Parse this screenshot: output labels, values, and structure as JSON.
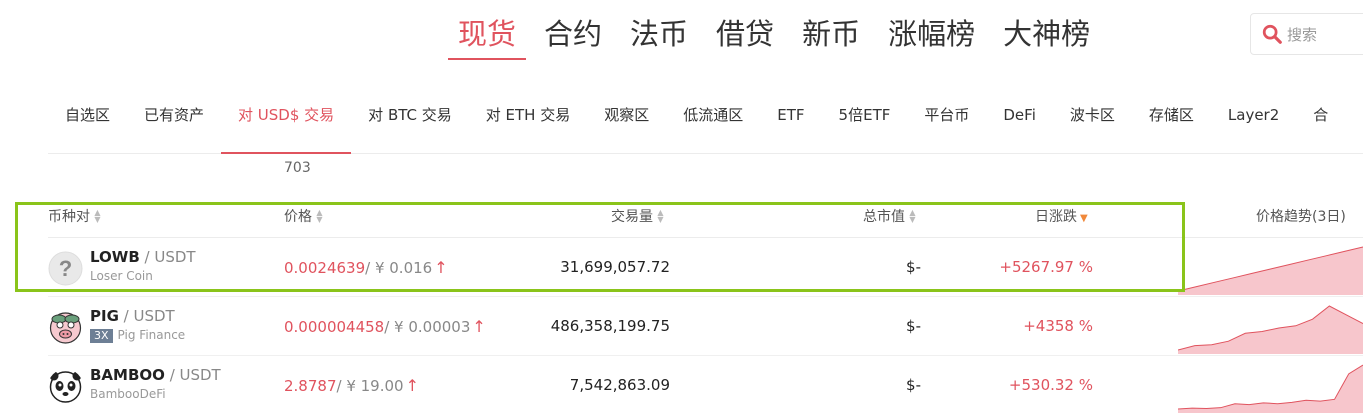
{
  "main_tabs": [
    "现货",
    "合约",
    "法币",
    "借贷",
    "新币",
    "涨幅榜",
    "大神榜"
  ],
  "search": {
    "placeholder": "搜索"
  },
  "sub_tabs": [
    "自选区",
    "已有资产",
    "对 USD$ 交易",
    "对 BTC 交易",
    "对 ETH 交易",
    "观察区",
    "低流通区",
    "ETF",
    "5倍ETF",
    "平台币",
    "DeFi",
    "波卡区",
    "存储区",
    "Layer2",
    "合"
  ],
  "active_sub_tab": "对 USD$ 交易",
  "count": "703",
  "table": {
    "headers": {
      "pair": "币种对",
      "price": "价格",
      "volume": "交易量",
      "mcap": "总市值",
      "change": "日涨跌",
      "trend": "价格趋势(3日)"
    },
    "rows": [
      {
        "symbol": "LOWB",
        "quote": "/ USDT",
        "full_name": "Loser Coin",
        "leverage": "",
        "price_usd": "0.0024639",
        "price_cny": "/ ¥ 0.016",
        "volume": "31,699,057.72",
        "mcap": "$-",
        "change": "+5267.97 %",
        "trend": [
          0,
          0.1,
          0.2,
          0.3,
          0.4,
          0.5,
          0.6,
          0.7,
          0.8,
          0.9,
          1
        ]
      },
      {
        "symbol": "PIG",
        "quote": "/ USDT",
        "full_name": "Pig Finance",
        "leverage": "3X",
        "price_usd": "0.000004458",
        "price_cny": "/ ¥ 0.00003",
        "volume": "486,358,199.75",
        "mcap": "$-",
        "change": "+4358 %",
        "trend": [
          0,
          0.1,
          0.12,
          0.2,
          0.38,
          0.42,
          0.5,
          0.55,
          0.7,
          1,
          0.8,
          0.6
        ]
      },
      {
        "symbol": "BAMBOO",
        "quote": "/ USDT",
        "full_name": "BambooDeFi",
        "leverage": "",
        "price_usd": "2.8787",
        "price_cny": "/ ¥ 19.00",
        "volume": "7,542,863.09",
        "mcap": "$-",
        "change": "+530.32 %",
        "trend": [
          0,
          0.02,
          0.01,
          0.03,
          0.12,
          0.1,
          0.14,
          0.12,
          0.15,
          0.2,
          0.18,
          0.22,
          0.8,
          1
        ]
      }
    ]
  }
}
